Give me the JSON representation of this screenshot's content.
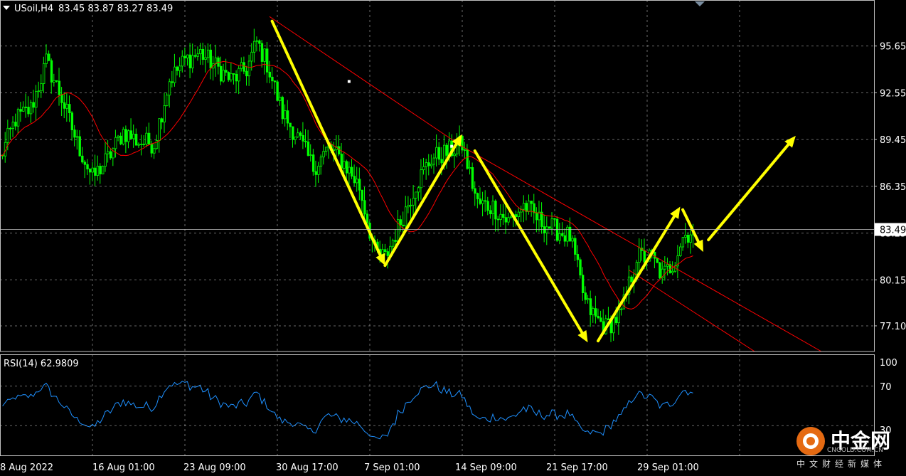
{
  "header": {
    "symbol": "USoil,H4",
    "ohlc": "83.45 83.87 83.27 83.49"
  },
  "rsi_label": "RSI(14) 62.9809",
  "current_price_label": "83.49",
  "logo": {
    "name_cn": "中金网",
    "domain": "CNGOLD.COM.CN",
    "slogan": "中文财经新媒体"
  },
  "colors": {
    "background": "#000000",
    "grid": "#c0c0c0",
    "bull_candle": "#00ff00",
    "ma_line": "#ff0000",
    "trendline": "#ff0000",
    "arrows": "#ffff00",
    "rsi_line": "#1e90ff",
    "axis_text": "#ffffff"
  },
  "chart_data": [
    {
      "type": "candlestick",
      "symbol": "USoil",
      "timeframe": "H4",
      "y_ticks": [
        77.1,
        80.15,
        83.25,
        86.35,
        89.45,
        92.55,
        95.65
      ],
      "ylim": [
        75.4,
        98.7
      ],
      "x_tick_labels": [
        "8 Aug 2022",
        "16 Aug 01:00",
        "23 Aug 09:00",
        "30 Aug 17:00",
        "7 Sep 01:00",
        "14 Sep 09:00",
        "21 Sep 17:00",
        "29 Sep 01:00"
      ],
      "anchors": [
        {
          "bar": 0,
          "price": 88.2
        },
        {
          "bar": 6,
          "price": 90.8
        },
        {
          "bar": 12,
          "price": 91.5
        },
        {
          "bar": 18,
          "price": 94.6
        },
        {
          "bar": 24,
          "price": 92.2
        },
        {
          "bar": 30,
          "price": 89.2
        },
        {
          "bar": 36,
          "price": 86.9
        },
        {
          "bar": 42,
          "price": 88.2
        },
        {
          "bar": 48,
          "price": 90.0
        },
        {
          "bar": 54,
          "price": 89.3
        },
        {
          "bar": 60,
          "price": 89.2
        },
        {
          "bar": 66,
          "price": 93.4
        },
        {
          "bar": 72,
          "price": 94.7
        },
        {
          "bar": 78,
          "price": 95.2
        },
        {
          "bar": 84,
          "price": 94.3
        },
        {
          "bar": 90,
          "price": 93.4
        },
        {
          "bar": 96,
          "price": 94.1
        },
        {
          "bar": 100,
          "price": 95.9
        },
        {
          "bar": 104,
          "price": 94.5
        },
        {
          "bar": 110,
          "price": 91.2
        },
        {
          "bar": 116,
          "price": 89.6
        },
        {
          "bar": 122,
          "price": 87.6
        },
        {
          "bar": 128,
          "price": 88.9
        },
        {
          "bar": 134,
          "price": 87.9
        },
        {
          "bar": 140,
          "price": 86.3
        },
        {
          "bar": 146,
          "price": 82.0
        },
        {
          "bar": 150,
          "price": 81.6
        },
        {
          "bar": 156,
          "price": 84.0
        },
        {
          "bar": 162,
          "price": 86.5
        },
        {
          "bar": 168,
          "price": 88.2
        },
        {
          "bar": 174,
          "price": 88.6
        },
        {
          "bar": 180,
          "price": 89.1
        },
        {
          "bar": 186,
          "price": 85.2
        },
        {
          "bar": 192,
          "price": 85.0
        },
        {
          "bar": 198,
          "price": 84.0
        },
        {
          "bar": 204,
          "price": 85.1
        },
        {
          "bar": 210,
          "price": 84.1
        },
        {
          "bar": 216,
          "price": 83.5
        },
        {
          "bar": 222,
          "price": 83.0
        },
        {
          "bar": 228,
          "price": 78.6
        },
        {
          "bar": 232,
          "price": 77.6
        },
        {
          "bar": 236,
          "price": 77.0
        },
        {
          "bar": 242,
          "price": 77.9
        },
        {
          "bar": 248,
          "price": 81.7
        },
        {
          "bar": 254,
          "price": 81.6
        },
        {
          "bar": 258,
          "price": 80.4
        },
        {
          "bar": 262,
          "price": 81.2
        },
        {
          "bar": 266,
          "price": 83.0
        },
        {
          "bar": 270,
          "price": 83.5
        }
      ],
      "series": [
        {
          "type": "moving_average",
          "period": 20
        },
        {
          "type": "rsi",
          "period": 14,
          "last_value": 62.9809,
          "levels": [
            30,
            70,
            100
          ]
        }
      ]
    }
  ],
  "annotations": {
    "trendline": [
      {
        "bar": 105,
        "price": 97.6
      },
      {
        "bar": 180,
        "price": 89.0
      },
      {
        "bar": 320,
        "price": 75.4
      }
    ],
    "arrows": [
      {
        "from": {
          "bar": 106,
          "price": 97.3
        },
        "to": {
          "bar": 150,
          "price": 81.1
        }
      },
      {
        "from": {
          "bar": 150,
          "price": 81.1
        },
        "to": {
          "bar": 180,
          "price": 89.8
        }
      },
      {
        "from": {
          "bar": 185,
          "price": 88.7
        },
        "to": {
          "bar": 229,
          "price": 76.0
        }
      },
      {
        "from": {
          "bar": 233,
          "price": 76.1
        },
        "to": {
          "bar": 265,
          "price": 85.0
        }
      },
      {
        "from": {
          "bar": 266,
          "price": 84.8
        },
        "to": {
          "bar": 274,
          "price": 82.0
        }
      },
      {
        "from": {
          "bar": 276,
          "price": 82.8
        },
        "to": {
          "bar": 310,
          "price": 89.7
        }
      }
    ]
  }
}
